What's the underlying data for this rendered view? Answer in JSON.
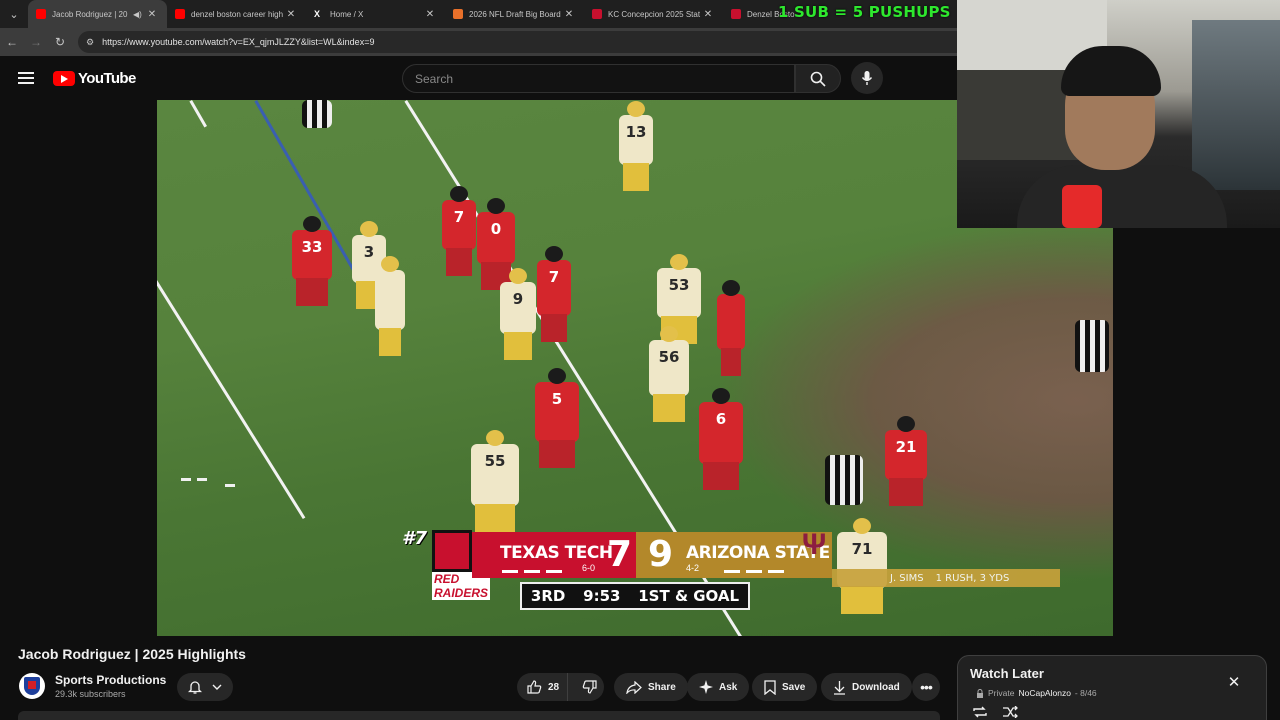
{
  "browser": {
    "tabs": [
      {
        "title": "Jacob Rodriguez | 20",
        "favicon_color": "#ff0000",
        "active": true,
        "muted_icon": "speaker-icon"
      },
      {
        "title": "denzel boston career high",
        "favicon_color": "#ff0000",
        "active": false
      },
      {
        "title": "Home / X",
        "favicon_color": "#ffffff",
        "active": false
      },
      {
        "title": "2026 NFL Draft Big Board",
        "favicon_color": "#e8702a",
        "active": false
      },
      {
        "title": "KC Concepcion 2025 Stat",
        "favicon_color": "#c8102e",
        "active": false
      },
      {
        "title": "Denzel Bosto",
        "favicon_color": "#c8102e",
        "active": false
      }
    ],
    "url": "https://www.youtube.com/watch?v=EX_qjmJLZZY&list=WL&index=9"
  },
  "overlay": {
    "sub_banner": "1 SUB = 5 PUSHUPS"
  },
  "youtube": {
    "logo_text": "YouTube",
    "search_placeholder": "Search"
  },
  "scorebug": {
    "rank": "#7",
    "home_mascot": "RED RAIDERS",
    "home_team": "TEXAS TECH",
    "home_score": "7",
    "home_record": "6-0",
    "away_team": "ARIZONA STATE",
    "away_score": "9",
    "away_record": "4-2",
    "quarter": "3RD",
    "clock": "9:53",
    "down": "1ST & GOAL",
    "stat_player": "J. SIMS",
    "stat_line": "1 RUSH, 3 YDS",
    "home_color": "#c8102e",
    "away_color": "#b3882a"
  },
  "video": {
    "title": "Jacob Rodriguez | 2025 Highlights",
    "channel_name": "Sports Productions",
    "subscribers": "29.3k subscribers",
    "likes": "28",
    "actions": {
      "share": "Share",
      "ask": "Ask",
      "save": "Save",
      "download": "Download"
    }
  },
  "playlist": {
    "title": "Watch Later",
    "privacy": "Private",
    "owner": "NoCapAlonzo",
    "position": "- 8/46"
  }
}
